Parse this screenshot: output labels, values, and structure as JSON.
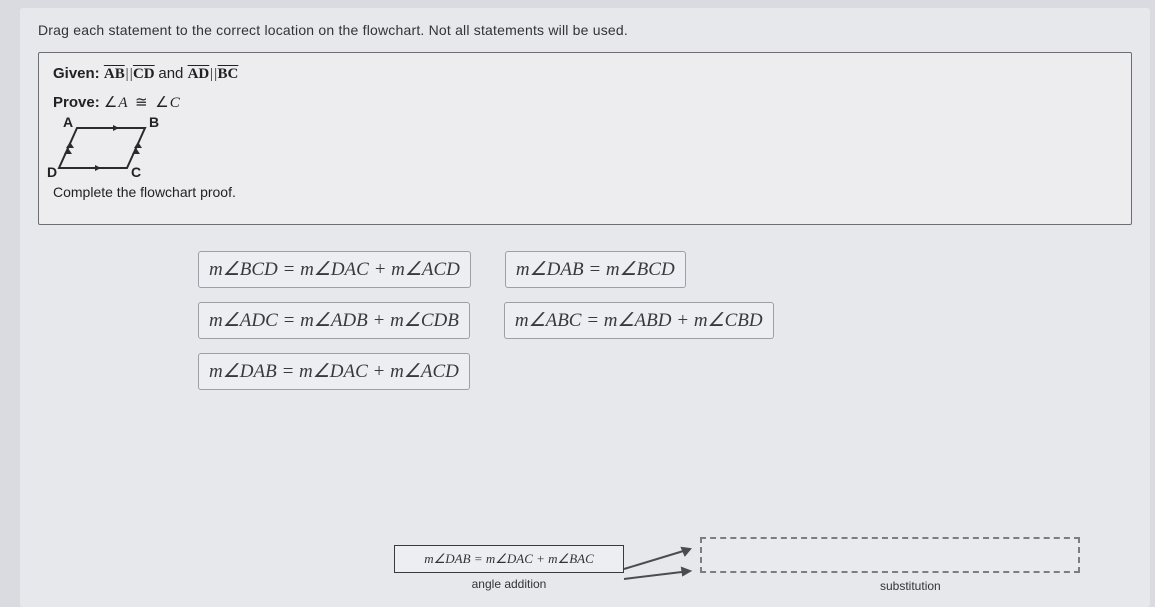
{
  "instruction": "Drag each statement to the correct location on the flowchart. Not all statements will be used.",
  "given": {
    "label": "Given:",
    "seg1a": "AB",
    "par1": "||",
    "seg1b": "CD",
    "and": " and ",
    "seg2a": "AD",
    "par2": "||",
    "seg2b": "BC"
  },
  "prove": {
    "label": "Prove:",
    "left": "A",
    "right": "C"
  },
  "diagram": {
    "A": "A",
    "B": "B",
    "C": "C",
    "D": "D"
  },
  "complete_text": "Complete the flowchart proof.",
  "tiles": {
    "t1": "m∠BCD = m∠DAC + m∠ACD",
    "t2": "m∠DAB = m∠BCD",
    "t3": "m∠ADC = m∠ADB + m∠CDB",
    "t4": "m∠ABC = m∠ABD + m∠CBD",
    "t5": "m∠DAB = m∠DAC + m∠ACD"
  },
  "flow": {
    "start_statement": "m∠DAB = m∠DAC + m∠BAC",
    "start_reason": "angle addition",
    "drop_reason": "substitution"
  }
}
